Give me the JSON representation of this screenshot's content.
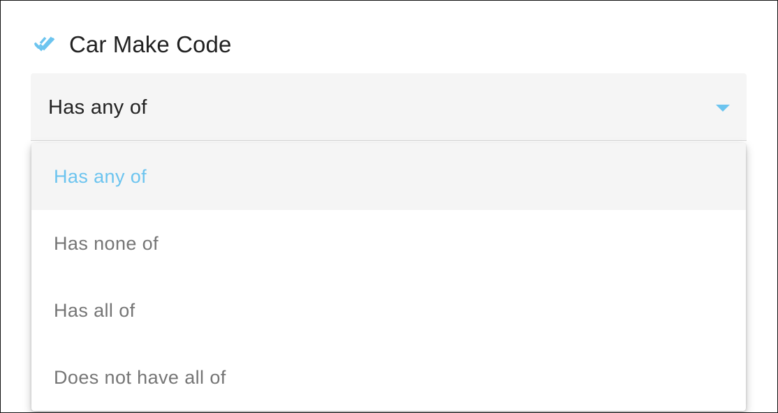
{
  "filter": {
    "title": "Car Make Code",
    "icon": "double-check-icon",
    "accent_color": "#6cc4ef"
  },
  "select": {
    "value": "Has any of",
    "caret_icon": "dropdown-caret-icon"
  },
  "menu": {
    "options": [
      {
        "label": "Has any of",
        "selected": true
      },
      {
        "label": "Has none of",
        "selected": false
      },
      {
        "label": "Has all of",
        "selected": false
      },
      {
        "label": "Does not have all of",
        "selected": false
      }
    ]
  }
}
